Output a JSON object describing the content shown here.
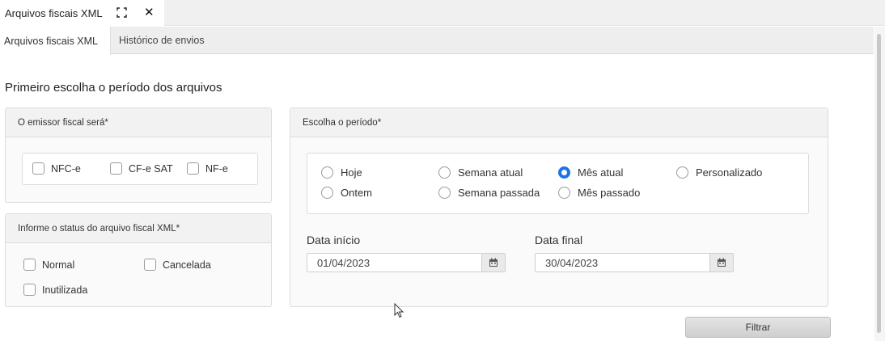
{
  "titlebar": {
    "title": "Arquivos fiscais XML",
    "expand_icon": "expand-icon",
    "close_icon": "close-icon",
    "close_glyph": "✕"
  },
  "tabs": [
    {
      "label": "Arquivos fiscais XML",
      "active": true
    },
    {
      "label": "Histórico de envios",
      "active": false
    }
  ],
  "heading": "Primeiro escolha o período dos arquivos",
  "emissor": {
    "header": "O emissor fiscal será*",
    "options": [
      {
        "label": "NFC-e",
        "checked": false
      },
      {
        "label": "CF-e SAT",
        "checked": false
      },
      {
        "label": "NF-e",
        "checked": false
      }
    ]
  },
  "status": {
    "header": "Informe o status do arquivo fiscal XML*",
    "options": [
      {
        "label": "Normal",
        "checked": false
      },
      {
        "label": "Cancelada",
        "checked": false
      },
      {
        "label": "Inutilizada",
        "checked": false
      }
    ]
  },
  "periodo": {
    "header": "Escolha o período*",
    "options": [
      {
        "label": "Hoje",
        "checked": false
      },
      {
        "label": "Semana atual",
        "checked": false
      },
      {
        "label": "Mês atual",
        "checked": true
      },
      {
        "label": "Personalizado",
        "checked": false
      },
      {
        "label": "Ontem",
        "checked": false
      },
      {
        "label": "Semana passada",
        "checked": false
      },
      {
        "label": "Mês passado",
        "checked": false
      }
    ],
    "data_inicio": {
      "label": "Data início",
      "value": "01/04/2023"
    },
    "data_final": {
      "label": "Data final",
      "value": "30/04/2023"
    }
  },
  "filter_button": "Filtrar",
  "colors": {
    "accent": "#1a73e8"
  }
}
